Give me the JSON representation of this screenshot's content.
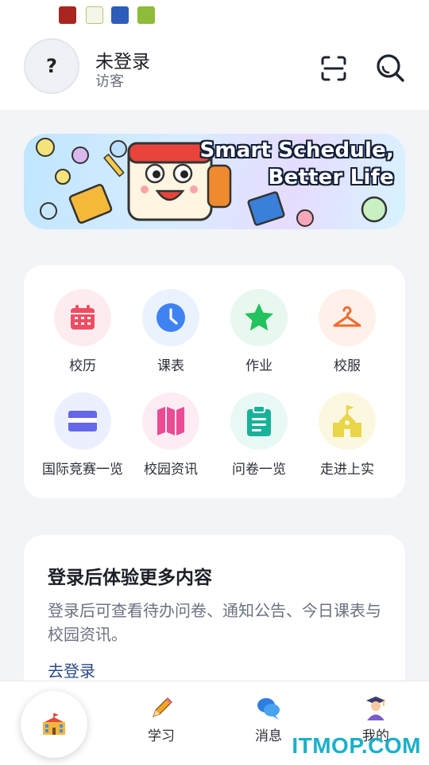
{
  "status_bar": {
    "icons": [
      "app-icon-red",
      "app-icon-yk",
      "app-icon-blue",
      "app-icon-green"
    ]
  },
  "header": {
    "avatar_text": "?",
    "user_name": "未登录",
    "user_role": "访客",
    "scan_icon": "scan-icon",
    "search_icon": "search-icon"
  },
  "banner": {
    "line1": "Smart Schedule,",
    "line2": "Better Life"
  },
  "menu": {
    "items": [
      {
        "label": "校历",
        "icon": "calendar-icon",
        "bg": "#fdecef",
        "color": "#ef4d64"
      },
      {
        "label": "课表",
        "icon": "clock-icon",
        "bg": "#eaf2fe",
        "color": "#3f82f3"
      },
      {
        "label": "作业",
        "icon": "star-icon",
        "bg": "#e8f8ee",
        "color": "#22c25c"
      },
      {
        "label": "校服",
        "icon": "hanger-icon",
        "bg": "#fff1ea",
        "color": "#f06a2e"
      },
      {
        "label": "国际竞赛一览",
        "icon": "card-icon",
        "bg": "#eceffe",
        "color": "#6566e9"
      },
      {
        "label": "校园资讯",
        "icon": "map-icon",
        "bg": "#fdecf4",
        "color": "#ea4b95"
      },
      {
        "label": "问卷一览",
        "icon": "clipboard-icon",
        "bg": "#e8f8f5",
        "color": "#18b29a"
      },
      {
        "label": "走进上实",
        "icon": "school-icon",
        "bg": "#fbf8df",
        "color": "#e9d548"
      }
    ]
  },
  "login_card": {
    "title": "登录后体验更多内容",
    "description": "登录后可查看待办问卷、通知公告、今日课表与校园资讯。",
    "link": "去登录"
  },
  "tabbar": {
    "home_icon": "school-building-icon",
    "tabs": [
      {
        "label": "学习",
        "icon": "pencil-icon"
      },
      {
        "label": "消息",
        "icon": "chat-bubbles-icon"
      },
      {
        "label": "我的",
        "icon": "graduate-icon"
      }
    ]
  },
  "watermark": "ITMOP.COM"
}
